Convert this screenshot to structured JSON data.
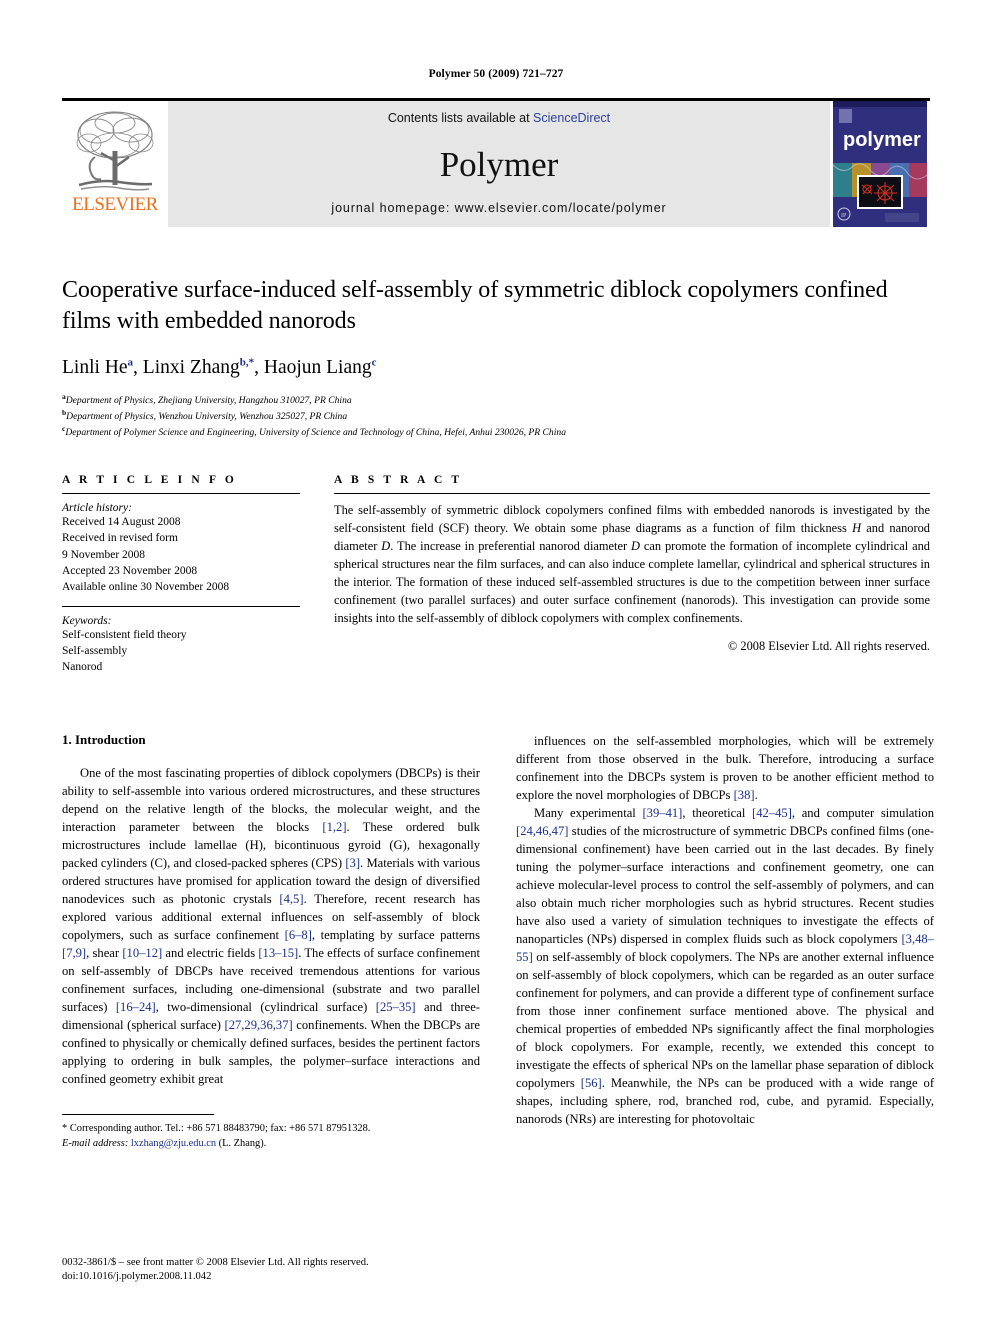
{
  "running_head": "Polymer 50 (2009) 721–727",
  "masthead": {
    "publisher_name": "ELSEVIER",
    "contents_prefix": "Contents lists available at ",
    "sciencedirect": "ScienceDirect",
    "journal_title": "Polymer",
    "homepage": "journal homepage: www.elsevier.com/locate/polymer",
    "cover_title": "polymer",
    "colors": {
      "elsevier_orange": "#E9711C",
      "link_blue": "#2b3f9e",
      "masthead_grey": "#e6e6e6",
      "cover_blue": "#2f2f7e"
    }
  },
  "article": {
    "title": "Cooperative surface-induced self-assembly of symmetric diblock copolymers confined films with embedded nanorods",
    "authors": [
      {
        "name": "Linli He",
        "marks": "a"
      },
      {
        "name": "Linxi Zhang",
        "marks": "b,*"
      },
      {
        "name": "Haojun Liang",
        "marks": "c"
      }
    ],
    "affiliations": [
      {
        "mark": "a",
        "text": "Department of Physics, Zhejiang University, Hangzhou 310027, PR China"
      },
      {
        "mark": "b",
        "text": "Department of Physics, Wenzhou University, Wenzhou 325027, PR China"
      },
      {
        "mark": "c",
        "text": "Department of Polymer Science and Engineering, University of Science and Technology of China, Hefei, Anhui 230026, PR China"
      }
    ]
  },
  "article_info": {
    "label": "A R T I C L E   I N F O",
    "history_label": "Article history:",
    "history": [
      "Received 14 August 2008",
      "Received in revised form",
      "9 November 2008",
      "Accepted 23 November 2008",
      "Available online 30 November 2008"
    ],
    "keywords_label": "Keywords:",
    "keywords": [
      "Self-consistent field theory",
      "Self-assembly",
      "Nanorod"
    ]
  },
  "abstract": {
    "label": "A B S T R A C T",
    "text": "The self-assembly of symmetric diblock copolymers confined films with embedded nanorods is investigated by the self-consistent field (SCF) theory. We obtain some phase diagrams as a function of film thickness H and nanorod diameter D. The increase in preferential nanorod diameter D can promote the formation of incomplete cylindrical and spherical structures near the film surfaces, and can also induce complete lamellar, cylindrical and spherical structures in the interior. The formation of these induced self-assembled structures is due to the competition between inner surface confinement (two parallel surfaces) and outer surface confinement (nanorods). This investigation can provide some insights into the self-assembly of diblock copolymers with complex confinements.",
    "copyright": "© 2008 Elsevier Ltd. All rights reserved."
  },
  "body": {
    "section_number_title": "1.  Introduction",
    "left_paragraph_1": "One of the most fascinating properties of diblock copolymers (DBCPs) is their ability to self-assemble into various ordered microstructures, and these structures depend on the relative length of the blocks, the molecular weight, and the interaction parameter between the blocks [1,2]. These ordered bulk microstructures include lamellae (H), bicontinuous gyroid (G), hexagonally packed cylinders (C), and closed-packed spheres (CPS) [3]. Materials with various ordered structures have promised for application toward the design of diversified nanodevices such as photonic crystals [4,5]. Therefore, recent research has explored various additional external influences on self-assembly of block copolymers, such as surface confinement [6–8], templating by surface patterns [7,9], shear [10–12] and electric fields [13–15]. The effects of surface confinement on self-assembly of DBCPs have received tremendous attentions for various confinement surfaces, including one-dimensional (substrate and two parallel surfaces) [16–24], two-dimensional (cylindrical surface) [25–35] and three-dimensional (spherical surface) [27,29,36,37] confinements. When the DBCPs are confined to physically or chemically defined surfaces, besides the pertinent factors applying to ordering in bulk samples, the polymer–surface interactions and confined geometry exhibit great",
    "right_paragraph_1": "influences on the self-assembled morphologies, which will be extremely different from those observed in the bulk. Therefore, introducing a surface confinement into the DBCPs system is proven to be another efficient method to explore the novel morphologies of DBCPs [38].",
    "right_paragraph_2": "Many experimental [39–41], theoretical [42–45], and computer simulation [24,46,47] studies of the microstructure of symmetric DBCPs confined films (one-dimensional confinement) have been carried out in the last decades. By finely tuning the polymer–surface interactions and confinement geometry, one can achieve molecular-level process to control the self-assembly of polymers, and can also obtain much richer morphologies such as hybrid structures. Recent studies have also used a variety of simulation techniques to investigate the effects of nanoparticles (NPs) dispersed in complex fluids such as block copolymers [3,48–55] on self-assembly of block copolymers. The NPs are another external influence on self-assembly of block copolymers, which can be regarded as an outer surface confinement for polymers, and can provide a different type of confinement surface from those inner confinement surface mentioned above. The physical and chemical properties of embedded NPs significantly affect the final morphologies of block copolymers. For example, recently, we extended this concept to investigate the effects of spherical NPs on the lamellar phase separation of diblock copolymers [56]. Meanwhile, the NPs can be produced with a wide range of shapes, including sphere, rod, branched rod, cube, and pyramid. Especially, nanorods (NRs) are interesting for photovoltaic"
  },
  "footnote": {
    "star": "*",
    "corresponding": "Corresponding author. Tel.: +86 571 88483790; fax: +86 571 87951328.",
    "email_label": "E-mail address:",
    "email": "lxzhang@zju.edu.cn",
    "email_suffix": "(L. Zhang)."
  },
  "page_footer": {
    "line1": "0032-3861/$ – see front matter © 2008 Elsevier Ltd. All rights reserved.",
    "line2": "doi:10.1016/j.polymer.2008.11.042"
  }
}
